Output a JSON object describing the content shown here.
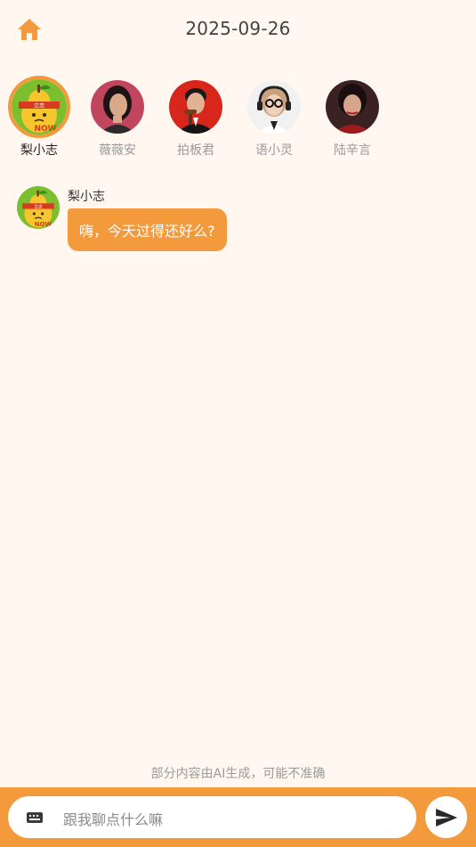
{
  "header": {
    "home_icon": "home-icon",
    "date": "2025-09-26"
  },
  "personas": [
    {
      "name": "梨小志",
      "selected": true,
      "avatar": "pear-mascot"
    },
    {
      "name": "薇薇安",
      "selected": false,
      "avatar": "woman-portrait"
    },
    {
      "name": "拍板君",
      "selected": false,
      "avatar": "man-gavel-portrait"
    },
    {
      "name": "语小灵",
      "selected": false,
      "avatar": "woman-headset-portrait"
    },
    {
      "name": "陆辛言",
      "selected": false,
      "avatar": "woman-red-portrait"
    }
  ],
  "messages": [
    {
      "sender": "梨小志",
      "text": "嗨，今天过得还好么?"
    }
  ],
  "disclaimer": "部分内容由AI生成，可能不准确",
  "input": {
    "placeholder": "跟我聊点什么嘛",
    "keyboard_icon": "keyboard-icon",
    "send_icon": "send-icon"
  },
  "colors": {
    "accent": "#f39a3d",
    "background": "#fff7f0"
  }
}
